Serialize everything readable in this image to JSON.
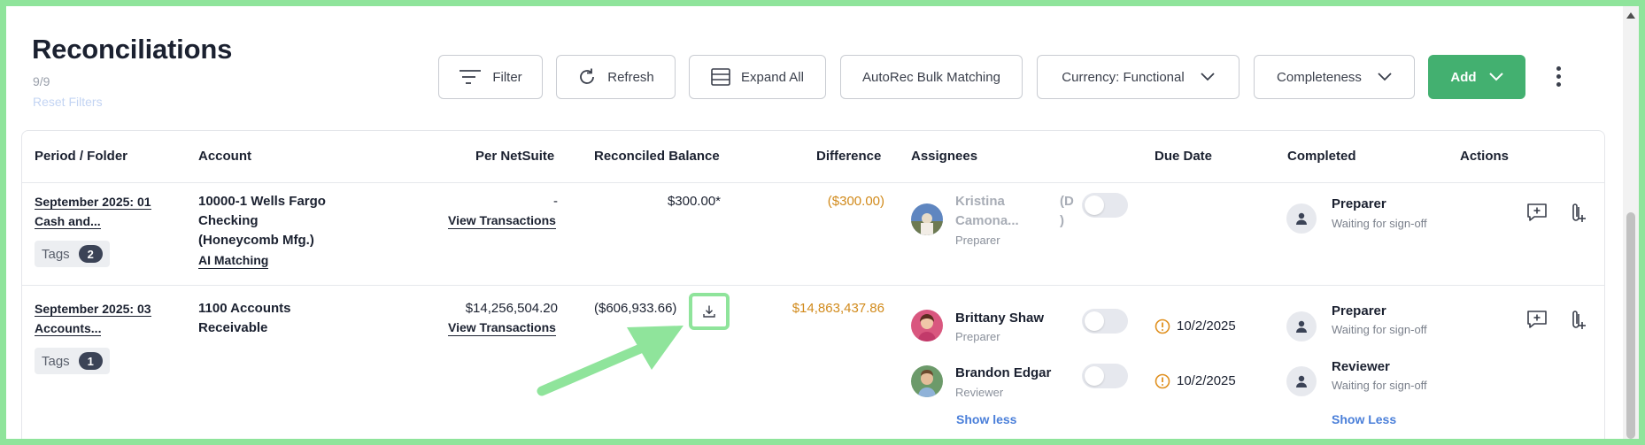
{
  "page": {
    "title": "Reconciliations",
    "count": "9/9",
    "reset_filters": "Reset Filters"
  },
  "toolbar": {
    "filter": "Filter",
    "refresh": "Refresh",
    "expand_all": "Expand All",
    "autorec": "AutoRec Bulk Matching",
    "currency": "Currency: Functional",
    "completeness": "Completeness",
    "add": "Add"
  },
  "table": {
    "headers": {
      "period": "Period / Folder",
      "account": "Account",
      "per_netsuite": "Per NetSuite",
      "reconciled_balance": "Reconciled Balance",
      "difference": "Difference",
      "assignees": "Assignees",
      "due_date": "Due Date",
      "completed": "Completed",
      "actions": "Actions"
    },
    "rows": [
      {
        "period_line1": "September 2025: 01",
        "period_line2": "Cash and...",
        "tags_label": "Tags",
        "tags_count": "2",
        "account_line1": "10000-1 Wells Fargo",
        "account_line2": "Checking",
        "account_line3": "(Honeycomb Mfg.)",
        "account_link": "AI Matching",
        "per_netsuite": "-",
        "view_transactions": "View Transactions",
        "reconciled_balance": "$300.00*",
        "difference": "($300.00)",
        "assignee_name_line1": "Kristina",
        "assignee_name_line2": "Camona...",
        "assignee_suffix_line1": "(D",
        "assignee_suffix_line2": ")",
        "assignee_role": "Preparer",
        "status_title": "Preparer",
        "status_sub": "Waiting for sign-off"
      },
      {
        "period_line1": "September 2025: 03",
        "period_line2": "Accounts...",
        "tags_label": "Tags",
        "tags_count": "1",
        "account_line1": "1100 Accounts",
        "account_line2": "Receivable",
        "per_netsuite": "$14,256,504.20",
        "view_transactions": "View Transactions",
        "reconciled_balance": "($606,933.66)",
        "difference": "$14,863,437.86",
        "assignees": [
          {
            "name": "Brittany Shaw",
            "role": "Preparer",
            "due": "10/2/2025"
          },
          {
            "name": "Brandon Edgar",
            "role": "Reviewer",
            "due": "10/2/2025"
          }
        ],
        "assignees_show_less": "Show less",
        "statuses": [
          {
            "title": "Preparer",
            "sub": "Waiting for sign-off"
          },
          {
            "title": "Reviewer",
            "sub": "Waiting for sign-off"
          }
        ],
        "completed_show_less": "Show Less"
      }
    ]
  },
  "colors": {
    "accent_green": "#43b070",
    "orange": "#d18a1b",
    "link_blue": "#4a7fd9",
    "annotation_green": "#8fe49b"
  }
}
